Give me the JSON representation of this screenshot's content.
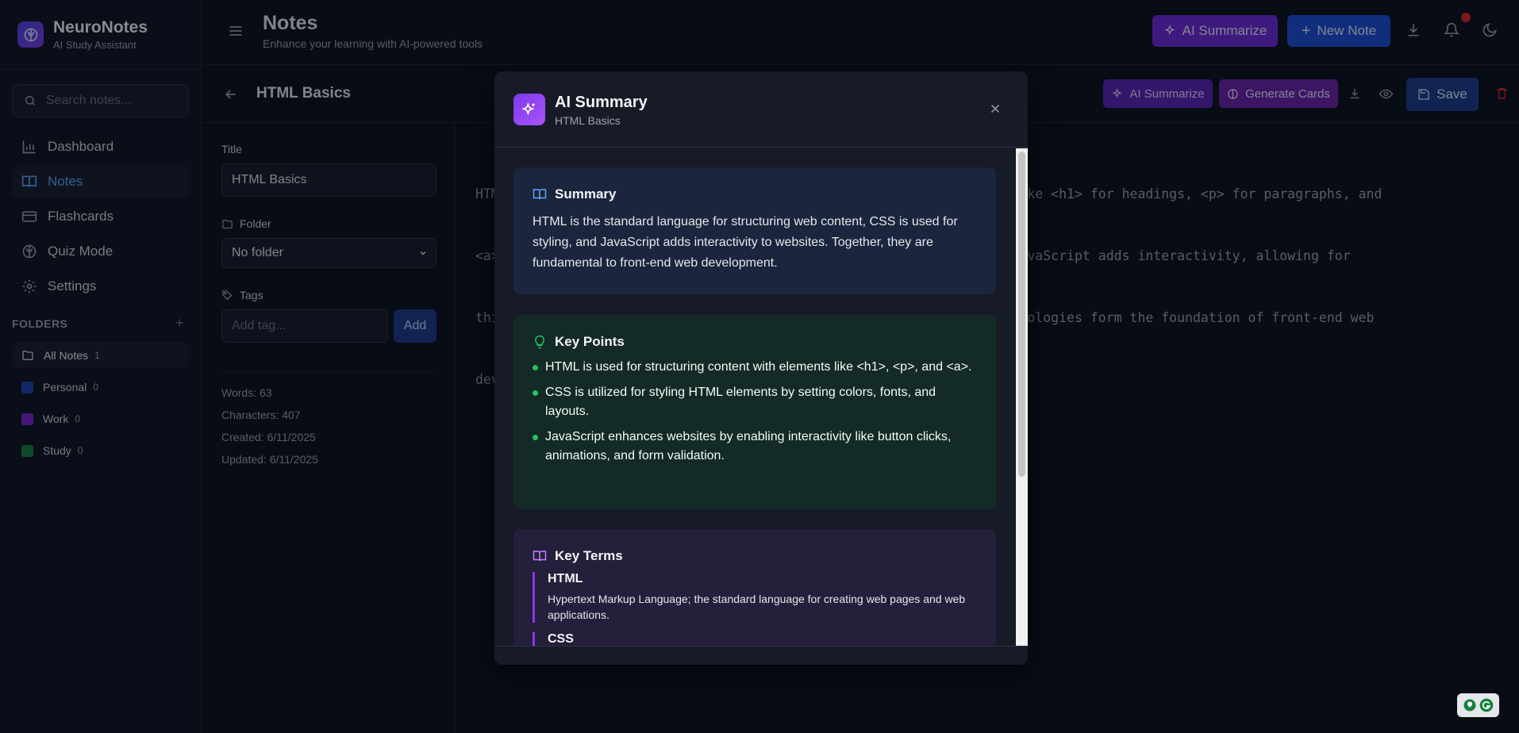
{
  "brand": {
    "name": "NeuroNotes",
    "subtitle": "AI Study Assistant"
  },
  "search": {
    "placeholder": "Search notes..."
  },
  "nav": [
    {
      "label": "Dashboard",
      "icon": "bar-chart-icon"
    },
    {
      "label": "Notes",
      "icon": "book-open-icon",
      "active": true
    },
    {
      "label": "Flashcards",
      "icon": "credit-card-icon"
    },
    {
      "label": "Quiz Mode",
      "icon": "brain-icon"
    },
    {
      "label": "Settings",
      "icon": "gear-icon"
    }
  ],
  "folders": {
    "heading": "FOLDERS",
    "items": [
      {
        "label": "All Notes",
        "count": "1",
        "active": true
      },
      {
        "label": "Personal",
        "count": "0",
        "color": "#1e40af"
      },
      {
        "label": "Work",
        "count": "0",
        "color": "#7e22ce"
      },
      {
        "label": "Study",
        "count": "0",
        "color": "#15803d"
      }
    ]
  },
  "topbar": {
    "title": "Notes",
    "subtitle": "Enhance your learning with AI-powered tools",
    "ai_button": "AI Summarize",
    "new_button": "New Note"
  },
  "editor": {
    "note_title": "HTML Basics",
    "ai_button": "AI Summarize",
    "cards_button": "Generate Cards",
    "save_button": "Save",
    "title_label": "Title",
    "title_value": "HTML Basics",
    "folder_label": "Folder",
    "folder_value": "No folder",
    "tags_label": "Tags",
    "tag_placeholder": "Add tag...",
    "add_button": "Add",
    "stats": {
      "words": "Words: 63",
      "characters": "Characters: 407",
      "created": "Created: 6/11/2025",
      "updated": "Updated: 6/11/2025"
    },
    "text_lines": [
      "HTM                                                    ses elements like <h1> for headings, <p> for paragraphs, and",
      "<a>                                                    and layouts. JavaScript adds interactivity, allowing for",
      "thi                                                    ese three technologies form the foundation of front-end web",
      "dev"
    ]
  },
  "modal": {
    "title": "AI Summary",
    "subtitle": "HTML Basics",
    "summary": {
      "heading": "Summary",
      "text": "HTML is the standard language for structuring web content, CSS is used for styling, and JavaScript adds interactivity to websites. Together, they are fundamental to front-end web development."
    },
    "key_points": {
      "heading": "Key Points",
      "items": [
        "HTML is used for structuring content with elements like <h1>, <p>, and <a>.",
        "CSS is utilized for styling HTML elements by setting colors, fonts, and layouts.",
        "JavaScript enhances websites by enabling interactivity like button clicks, animations, and form validation."
      ]
    },
    "key_terms": {
      "heading": "Key Terms",
      "items": [
        {
          "term": "HTML",
          "definition": "Hypertext Markup Language; the standard language for creating web pages and web applications."
        },
        {
          "term": "CSS",
          "definition": ""
        }
      ]
    }
  },
  "colors": {
    "accent_blue": "#1d4ed8",
    "accent_purple": "#6d28d9",
    "summary_bg": "#1b253d",
    "keypoints_bg": "#142a27",
    "keyterms_bg": "#241f3a"
  }
}
